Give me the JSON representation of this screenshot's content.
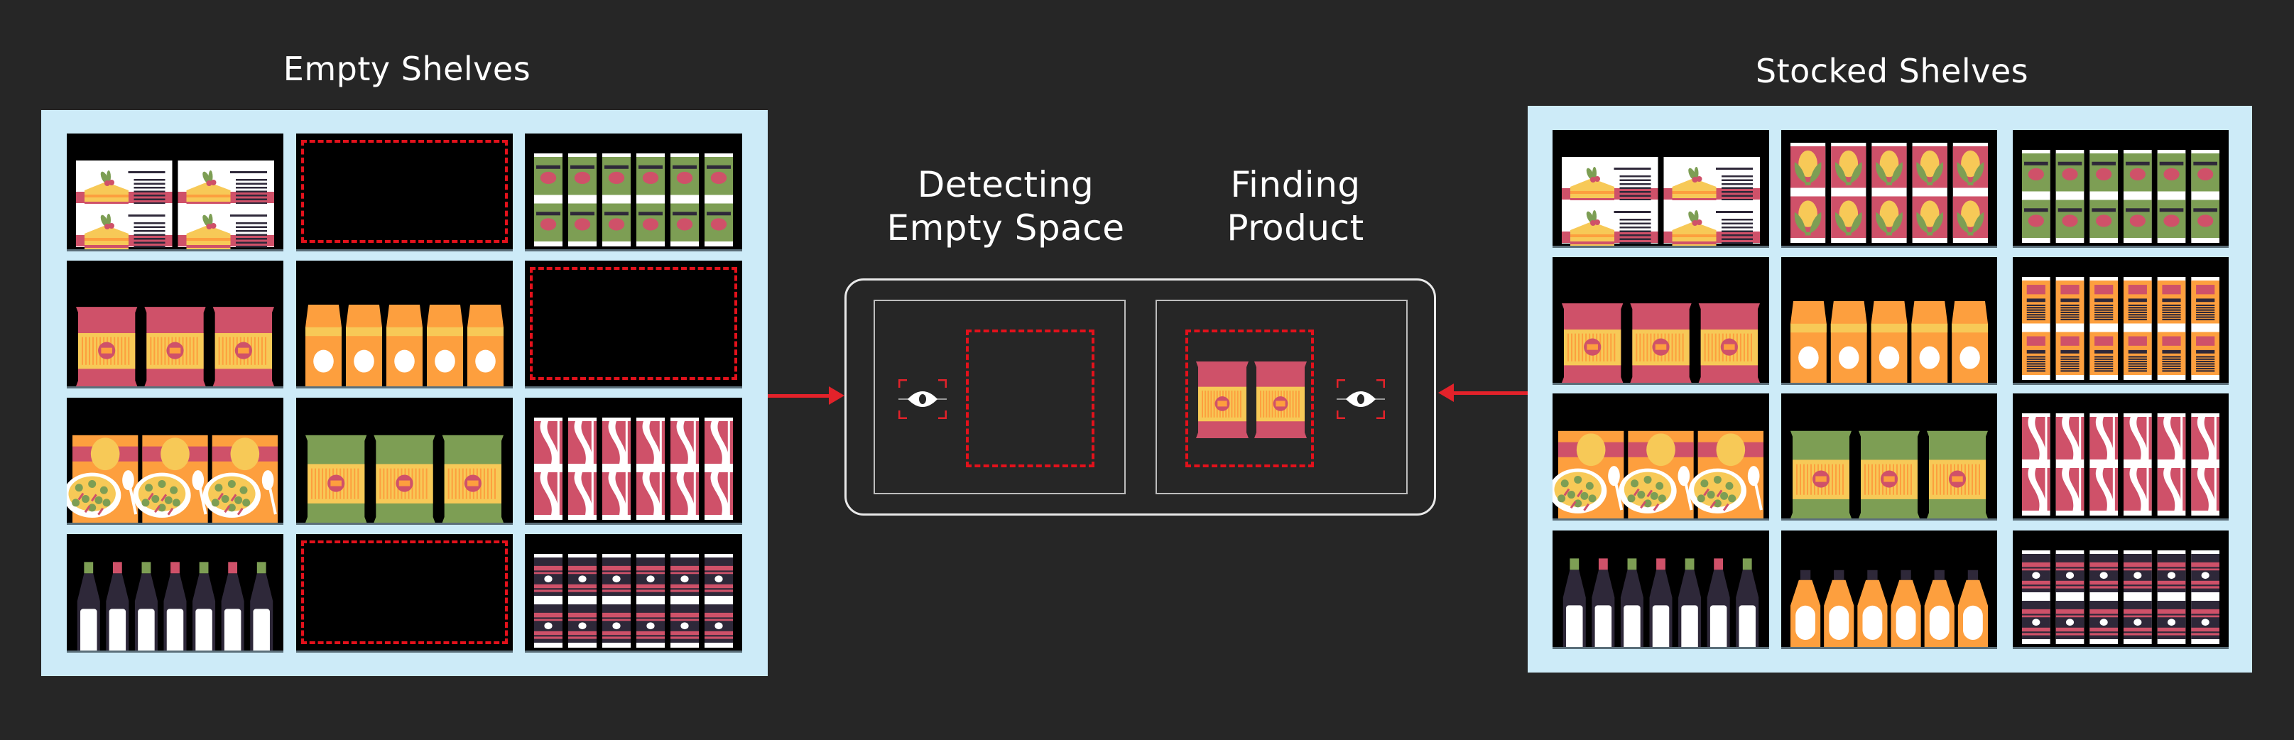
{
  "titles": {
    "empty_shelves": "Empty Shelves",
    "stocked_shelves": "Stocked Shelves",
    "detecting_line1": "Detecting",
    "detecting_line2": "Empty Space",
    "finding_line1": "Finding",
    "finding_line2": "Product"
  },
  "colors": {
    "background": "#262626",
    "shelf_unit": "#cdebf8",
    "shelf_cell": "#000000",
    "detection_red": "#e3222a",
    "pink": "#cf5169",
    "orange": "#fd9f3e",
    "yellow": "#f7c957",
    "green": "#7d9e54",
    "dark": "#2e2839",
    "white": "#ffffff"
  },
  "empty_shelves": {
    "grid": [
      [
        "cake-boxes",
        "empty",
        "green-cans"
      ],
      [
        "pink-chip-bags",
        "orange-cartons",
        "empty"
      ],
      [
        "pasta-boxes",
        "green-chip-bags",
        "bacon-cans"
      ],
      [
        "wine-bottles",
        "empty",
        "striped-cans"
      ]
    ]
  },
  "stocked_shelves": {
    "grid": [
      [
        "cake-boxes",
        "corn-cans",
        "green-cans"
      ],
      [
        "pink-chip-bags",
        "orange-cartons",
        "cereal-boxes"
      ],
      [
        "pasta-boxes",
        "green-chip-bags",
        "bacon-cans"
      ],
      [
        "wine-bottles",
        "juice-bottles",
        "striped-cans"
      ]
    ]
  },
  "process": {
    "steps": [
      {
        "name": "detecting-empty-space",
        "icon": "eye-scan-icon",
        "target": "empty-slot"
      },
      {
        "name": "finding-product",
        "icon": "eye-scan-icon",
        "target": "pink-chip-bags",
        "product_count": 2
      }
    ]
  }
}
